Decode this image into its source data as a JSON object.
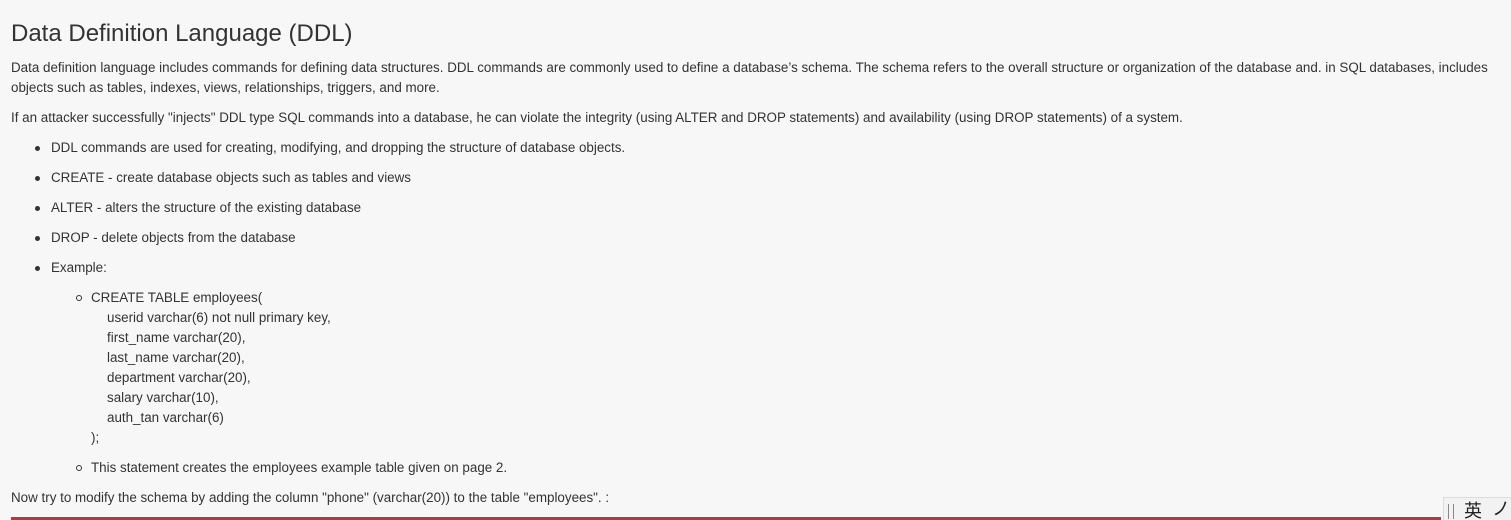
{
  "lesson": {
    "title": "Data Definition Language (DDL)",
    "intro": "Data definition language includes commands for defining data structures. DDL commands are commonly used to define a database’s schema. The schema refers to the overall structure or organization of the database and. in SQL databases, includes objects such as tables, indexes, views, relationships, triggers, and more.",
    "attack_note": "If an attacker successfully \"injects\" DDL type SQL commands into a database, he can violate the integrity (using ALTER and DROP statements) and availability (using DROP statements) of a system.",
    "bullets": [
      "DDL commands are used for creating, modifying, and dropping the structure of database objects.",
      "CREATE - create database objects such as tables and views",
      "ALTER - alters the structure of the existing database",
      "DROP - delete objects from the database",
      "Example:"
    ],
    "example": {
      "code_lines": [
        "CREATE TABLE employees(",
        "userid varchar(6) not null primary key,",
        "first_name varchar(20),",
        "last_name varchar(20),",
        "department varchar(20),",
        "salary varchar(10),",
        "auth_tan varchar(6)",
        ");"
      ],
      "note": "This statement creates the employees example table given on page 2."
    },
    "task": "Now try to modify the schema by adding the column \"phone\" (varchar(20)) to the table \"employees\". :"
  },
  "ime_toolbar": {
    "mode": "英",
    "punct": "ノ"
  },
  "colors": {
    "text": "#333333",
    "background": "#f7f7f7",
    "assignment_border": "#b03a48"
  }
}
